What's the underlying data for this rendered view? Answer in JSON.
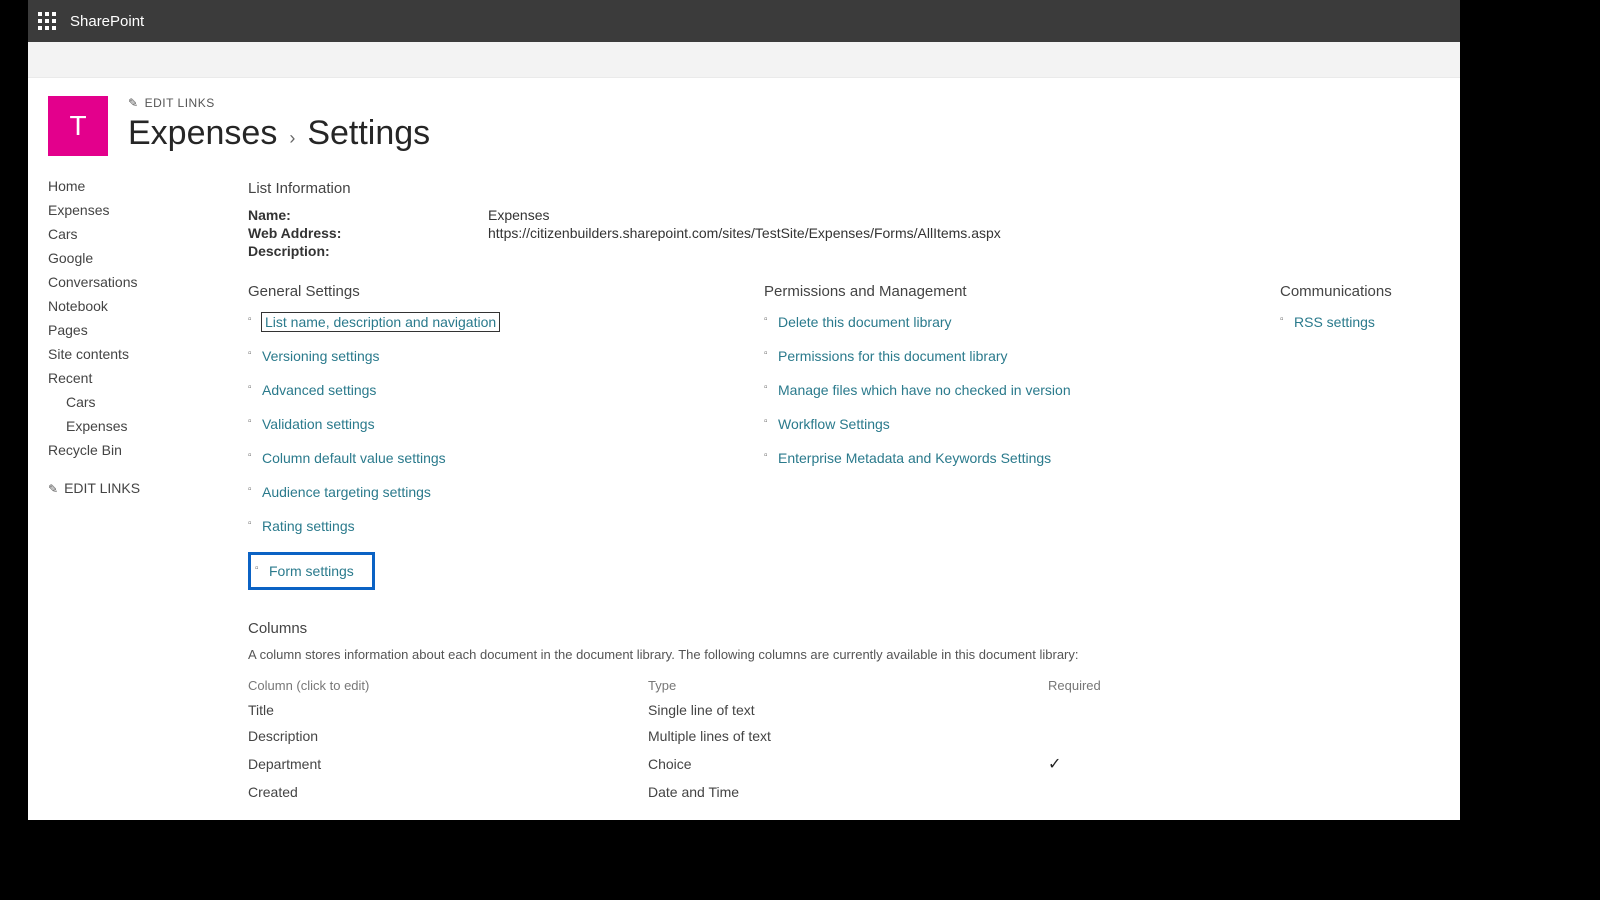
{
  "brand": "SharePoint",
  "site_logo_letter": "T",
  "edit_links_label": "EDIT LINKS",
  "breadcrumb": {
    "list": "Expenses",
    "page": "Settings"
  },
  "leftnav": {
    "items": [
      "Home",
      "Expenses",
      "Cars",
      "Google",
      "Conversations",
      "Notebook",
      "Pages",
      "Site contents",
      "Recent"
    ],
    "recent_sub": [
      "Cars",
      "Expenses"
    ],
    "recycle": "Recycle Bin",
    "edit_links": "EDIT LINKS"
  },
  "list_info": {
    "heading": "List Information",
    "name_label": "Name:",
    "name_value": "Expenses",
    "web_label": "Web Address:",
    "web_value": "https://citizenbuilders.sharepoint.com/sites/TestSite/Expenses/Forms/AllItems.aspx",
    "desc_label": "Description:",
    "desc_value": ""
  },
  "sections": {
    "general": {
      "heading": "General Settings",
      "links": [
        "List name, description and navigation",
        "Versioning settings",
        "Advanced settings",
        "Validation settings",
        "Column default value settings",
        "Audience targeting settings",
        "Rating settings",
        "Form settings"
      ]
    },
    "perms": {
      "heading": "Permissions and Management",
      "links": [
        "Delete this document library",
        "Permissions for this document library",
        "Manage files which have no checked in version",
        "Workflow Settings",
        "Enterprise Metadata and Keywords Settings"
      ]
    },
    "comm": {
      "heading": "Communications",
      "links": [
        "RSS settings"
      ]
    }
  },
  "columns_section": {
    "heading": "Columns",
    "blurb": "A column stores information about each document in the document library. The following columns are currently available in this document library:",
    "headers": {
      "col": "Column (click to edit)",
      "type": "Type",
      "req": "Required"
    },
    "rows": [
      {
        "name": "Title",
        "type": "Single line of text",
        "required": false
      },
      {
        "name": "Description",
        "type": "Multiple lines of text",
        "required": false
      },
      {
        "name": "Department",
        "type": "Choice",
        "required": true
      },
      {
        "name": "Created",
        "type": "Date and Time",
        "required": false
      }
    ]
  }
}
